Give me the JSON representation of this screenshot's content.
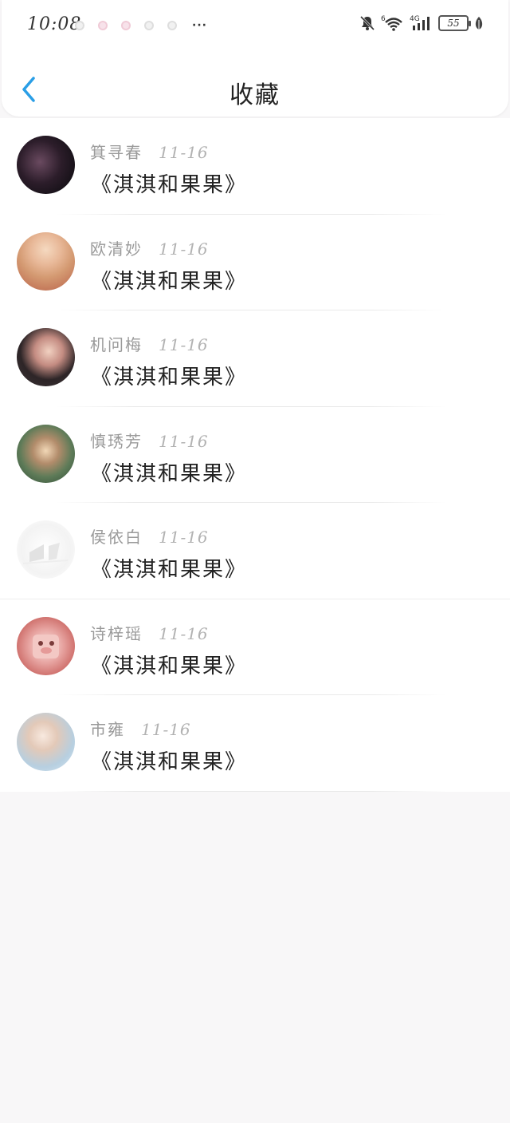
{
  "status_bar": {
    "time": "10:08",
    "notification_dots": [
      "neutral",
      "pink",
      "pink",
      "neutral",
      "neutral"
    ],
    "more": "···",
    "battery": "55",
    "icons": [
      "bell-muted-icon",
      "wifi-6-icon",
      "4g-signal-icon",
      "battery-icon",
      "leaf-icon"
    ]
  },
  "nav": {
    "title": "收藏",
    "back_icon": "chevron-left-icon"
  },
  "favorites": [
    {
      "name": "箕寻春",
      "date": "11-16",
      "book": "《淇淇和果果》"
    },
    {
      "name": "欧清妙",
      "date": "11-16",
      "book": "《淇淇和果果》"
    },
    {
      "name": "机问梅",
      "date": "11-16",
      "book": "《淇淇和果果》"
    },
    {
      "name": "慎琇芳",
      "date": "11-16",
      "book": "《淇淇和果果》"
    },
    {
      "name": "侯依白",
      "date": "11-16",
      "book": "《淇淇和果果》"
    },
    {
      "name": "诗梓瑶",
      "date": "11-16",
      "book": "《淇淇和果果》"
    },
    {
      "name": "市雍",
      "date": "11-16",
      "book": "《淇淇和果果》"
    }
  ],
  "colors": {
    "accent": "#2a9ee6",
    "background": "#f8f7f8",
    "name_text": "#9a9a9a",
    "title_text": "#222222"
  }
}
